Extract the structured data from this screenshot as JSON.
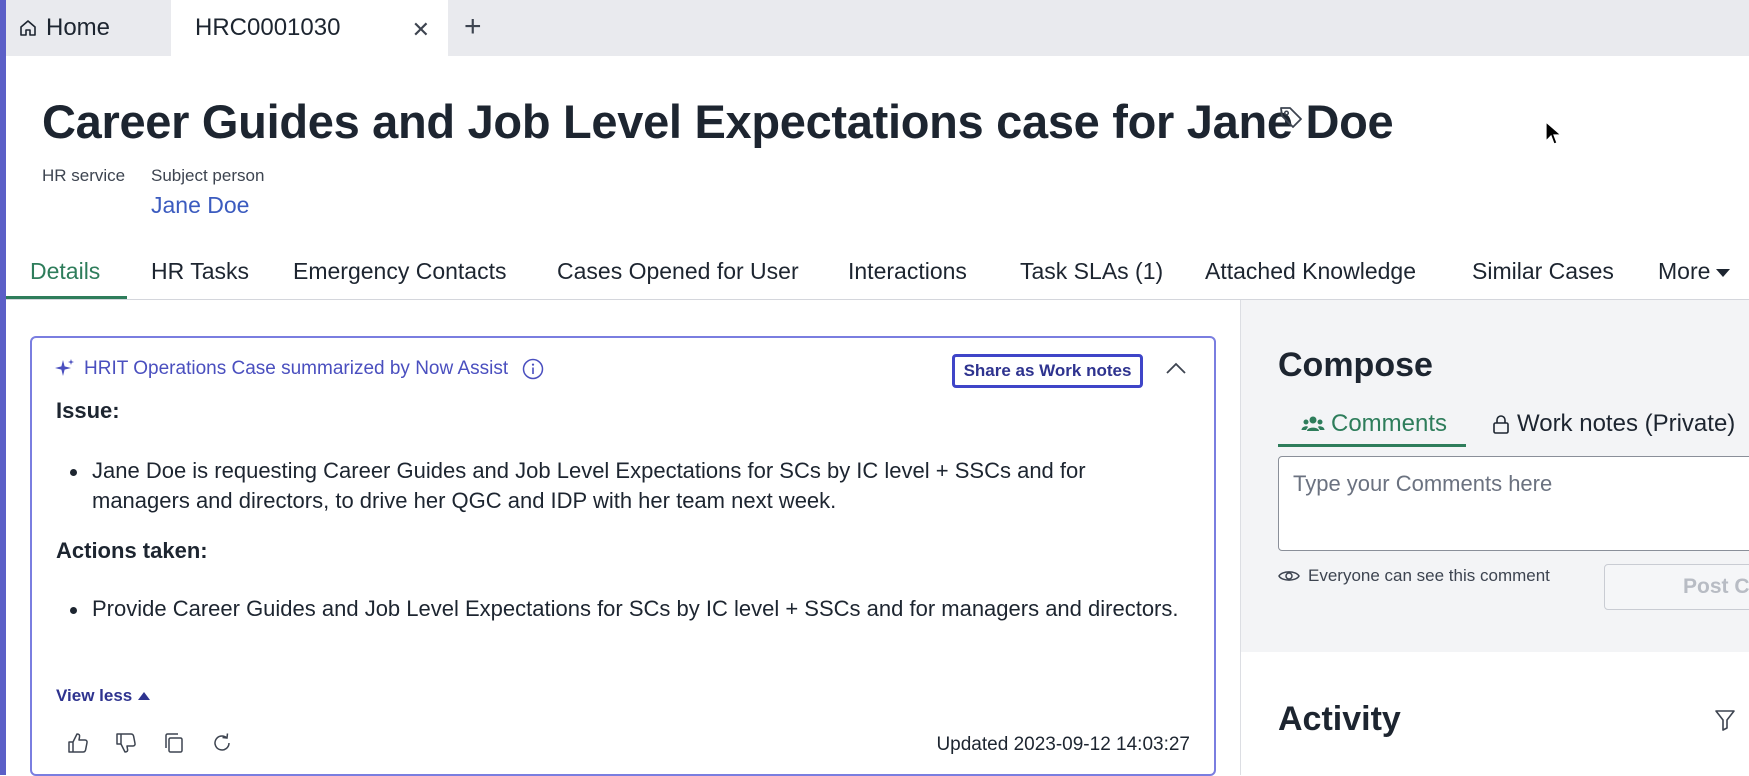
{
  "tabs": {
    "home_label": "Home",
    "case_label": "HRC0001030"
  },
  "header": {
    "title": "Career Guides and Job Level Expectations case for Jane Doe",
    "hr_service_label": "HR service",
    "subject_person_label": "Subject person",
    "subject_person_value": "Jane Doe"
  },
  "record_tabs": [
    {
      "label": "Details",
      "active": true
    },
    {
      "label": "HR Tasks"
    },
    {
      "label": "Emergency Contacts"
    },
    {
      "label": "Cases Opened for User"
    },
    {
      "label": "Interactions"
    },
    {
      "label": "Task SLAs (1)"
    },
    {
      "label": "Attached Knowledge"
    },
    {
      "label": "Similar Cases"
    },
    {
      "label": "More"
    }
  ],
  "summary": {
    "heading": "HRIT Operations Case summarized by Now Assist",
    "share_button": "Share as Work notes",
    "issue_heading": "Issue:",
    "issue_text": "Jane Doe is requesting Career Guides and Job Level Expectations for SCs by IC level + SSCs and for managers and directors, to drive her QGC and IDP with her team next week.",
    "actions_heading": "Actions taken:",
    "actions_text": "Provide Career Guides and Job Level Expectations for SCs by IC level + SSCs and for managers and directors.",
    "view_less": "View less",
    "updated": "Updated 2023-09-12 14:03:27"
  },
  "compose": {
    "title": "Compose",
    "tab_comments": "Comments",
    "tab_work_notes": "Work notes (Private)",
    "comment_placeholder": "Type your Comments here",
    "visibility_note": "Everyone can see this comment",
    "post_button": "Post Comment"
  },
  "activity": {
    "title": "Activity"
  },
  "colors": {
    "accent_green": "#2e7d5b",
    "assist_purple": "#4a4fbf",
    "link_blue": "#3b5bbf"
  }
}
